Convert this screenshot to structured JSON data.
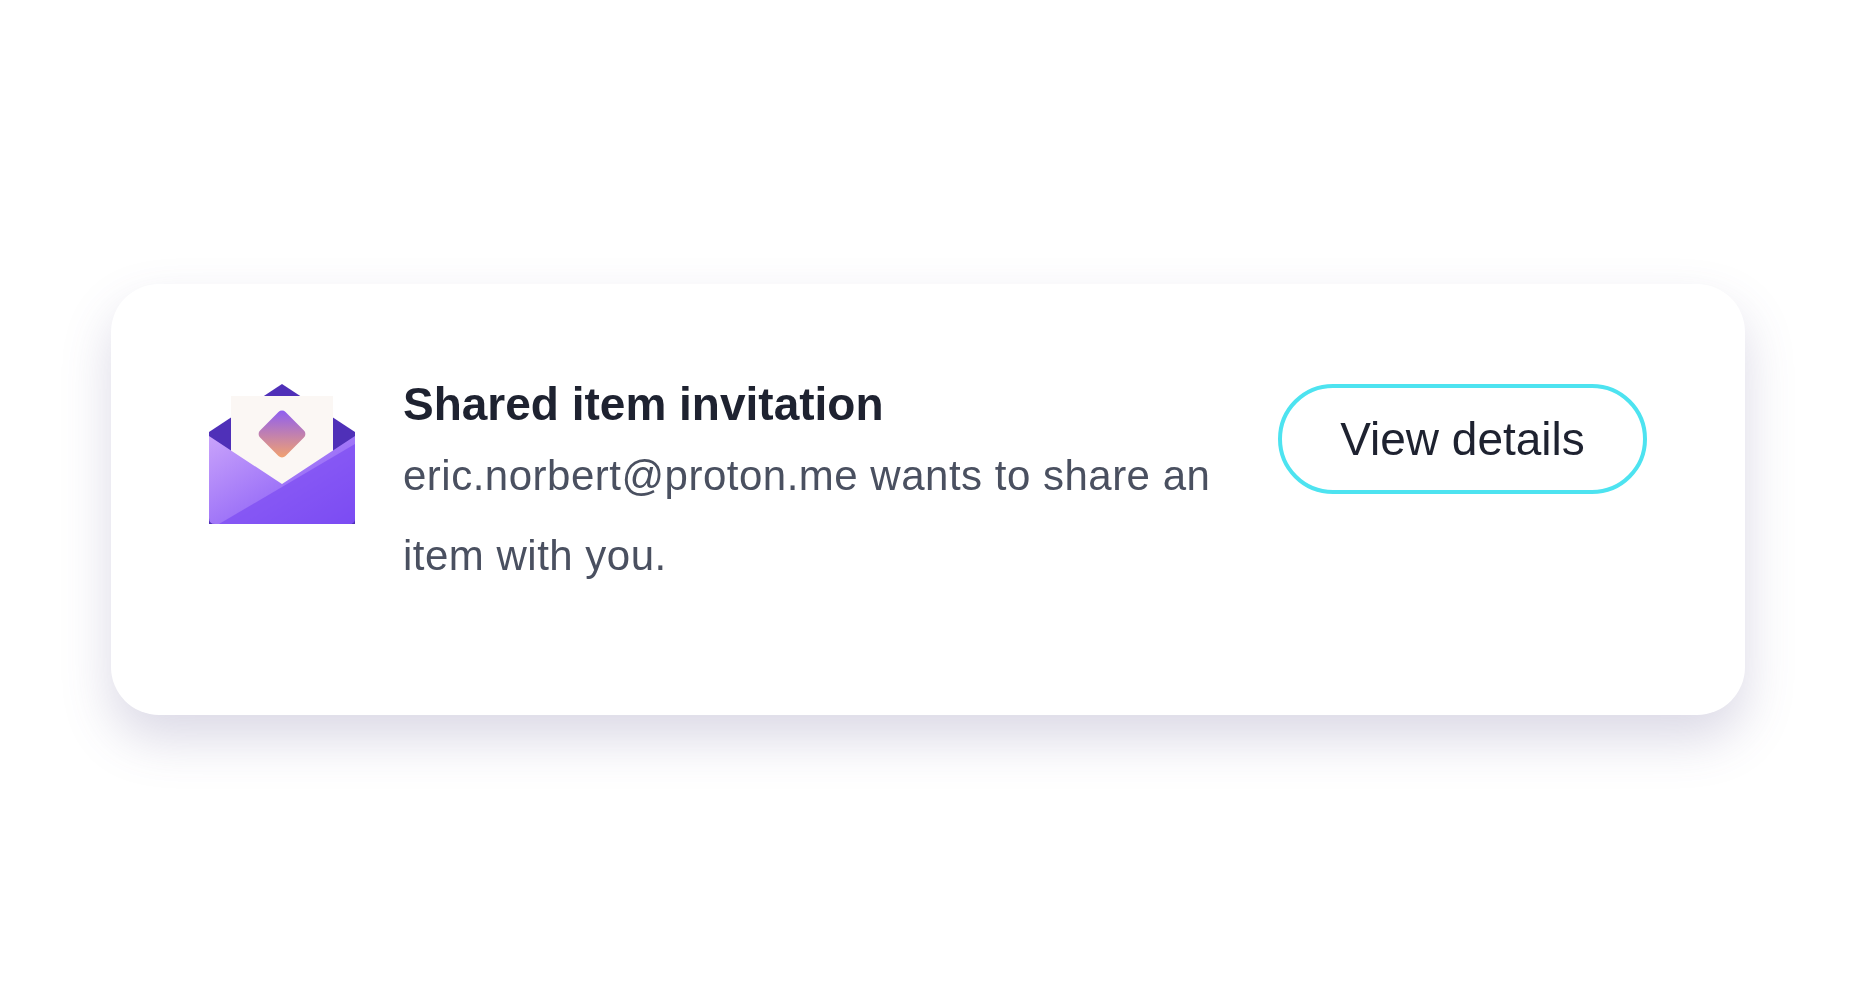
{
  "notification": {
    "title": "Shared item invitation",
    "message": "eric.norbert@proton.me wants to share an item with you.",
    "button": "View details"
  }
}
